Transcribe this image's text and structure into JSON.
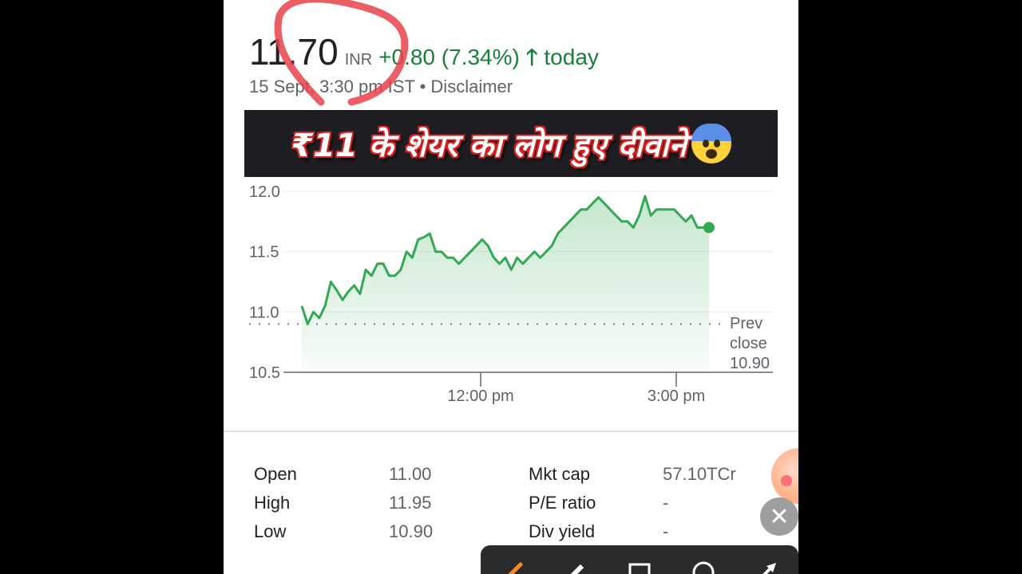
{
  "quote": {
    "price": "11.70",
    "currency": "INR",
    "change": "+0.80 (7.34%)",
    "arrow_icon": "arrow-up-icon",
    "today": "today",
    "date_line": "15 Sept, 3:30 pm IST • Disclaimer"
  },
  "banner": {
    "text": "₹11 के शेयर का लोग हुए दीवाने"
  },
  "chart_data": {
    "type": "area",
    "y_ticks": [
      "12.0",
      "11.5",
      "11.0",
      "10.5"
    ],
    "x_ticks": [
      "12:00 pm",
      "3:00 pm"
    ],
    "ylim": [
      10.5,
      12.0
    ],
    "prev_close": {
      "label": "Prev close",
      "value": "10.90"
    },
    "series": [
      {
        "values": [
          11.05,
          10.9,
          11.0,
          10.95,
          11.05,
          11.25,
          11.18,
          11.1,
          11.17,
          11.22,
          11.15,
          11.35,
          11.3,
          11.4,
          11.4,
          11.3,
          11.3,
          11.35,
          11.5,
          11.45,
          11.6,
          11.62,
          11.65,
          11.5,
          11.5,
          11.45,
          11.45,
          11.4,
          11.45,
          11.5,
          11.55,
          11.6,
          11.55,
          11.45,
          11.4,
          11.45,
          11.35,
          11.45,
          11.4,
          11.45,
          11.5,
          11.45,
          11.5,
          11.55,
          11.65,
          11.7,
          11.75,
          11.8,
          11.85,
          11.85,
          11.9,
          11.95,
          11.9,
          11.85,
          11.8,
          11.75,
          11.75,
          11.7,
          11.8,
          11.96,
          11.8,
          11.85,
          11.85,
          11.85,
          11.85,
          11.8,
          11.75,
          11.8,
          11.7,
          11.7,
          11.7
        ]
      }
    ],
    "color": "#34a853",
    "grid": true
  },
  "stats": [
    {
      "label": "Open",
      "value": "11.00"
    },
    {
      "label": "High",
      "value": "11.95"
    },
    {
      "label": "Low",
      "value": "10.90"
    },
    {
      "label": "Mkt cap",
      "value": "57.10TCr"
    },
    {
      "label": "P/E ratio",
      "value": "-"
    },
    {
      "label": "Div yield",
      "value": "-"
    }
  ],
  "close_icon": "close-icon",
  "toolbar": {
    "icons": [
      "pen-icon",
      "highlighter-icon",
      "rectangle-icon",
      "circle-icon",
      "arrow-tool-icon"
    ]
  }
}
